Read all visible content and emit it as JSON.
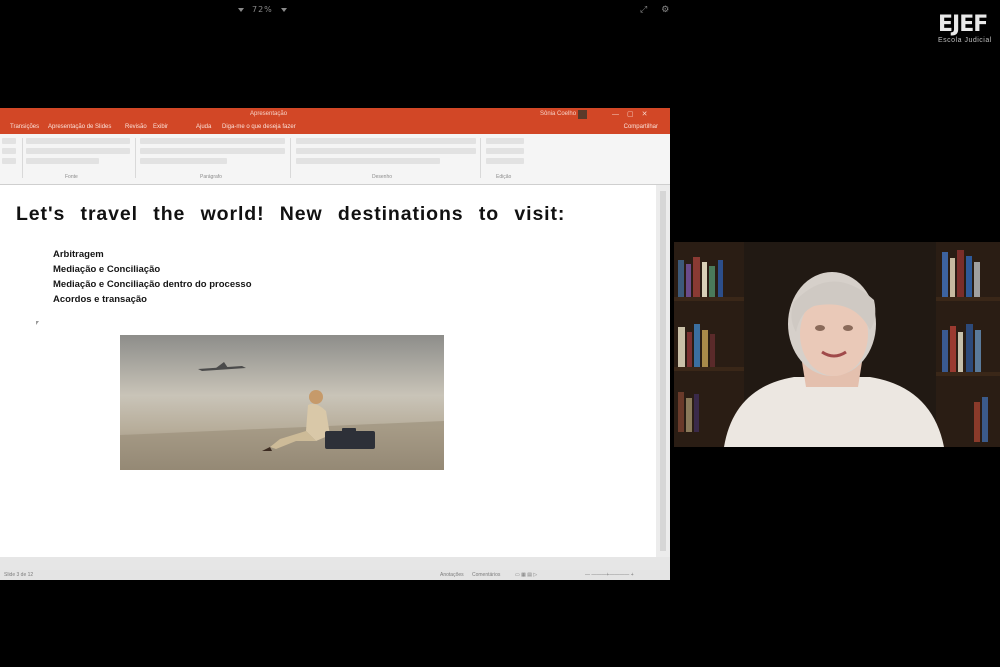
{
  "meeting": {
    "zoom_level": "72%",
    "watermark": {
      "brand": "EJEF",
      "subtitle": "Escola Judicial"
    }
  },
  "window": {
    "document_title": "Apresentação",
    "user_name": "Sônia Coelho",
    "tabs": [
      "Transições",
      "Apresentação de Slides",
      "Revisão",
      "Exibir",
      "Ajuda",
      "Diga-me o que deseja fazer"
    ],
    "share_label": "Compartilhar",
    "ribbon_groups": [
      "Fonte",
      "Parágrafo",
      "Desenho",
      "Edição"
    ]
  },
  "slide": {
    "title": "Let's travel the world! New destinations to visit:",
    "bullets": [
      "Arbitragem",
      "Mediação e Conciliação",
      "Mediação e Conciliação dentro do processo",
      "Acordos e transação"
    ]
  },
  "status": {
    "slide_info": "Slide 3 de 12",
    "notes_label": "Anotações",
    "comments_label": "Comentários"
  },
  "colors": {
    "ppt_accent": "#d24726",
    "background": "#000000"
  },
  "icons": {
    "window_controls": "minimize-maximize-close-icons",
    "zoom_controls": "chevron-icons"
  }
}
